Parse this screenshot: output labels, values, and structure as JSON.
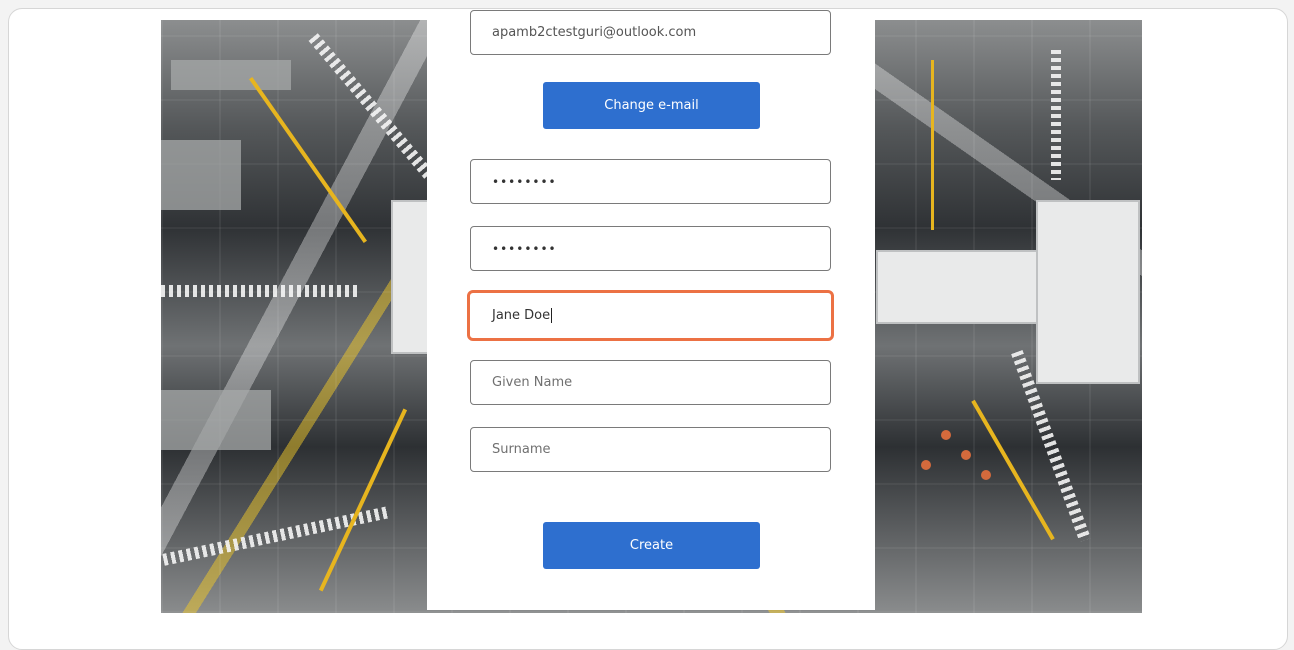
{
  "form": {
    "email_value": "apamb2ctestguri@outlook.com",
    "change_email_label": "Change e-mail",
    "new_password_value": "••••••••",
    "confirm_password_value": "••••••••",
    "display_name_value": "Jane Doe",
    "given_name_placeholder": "Given Name",
    "surname_placeholder": "Surname",
    "create_label": "Create"
  },
  "colors": {
    "primary_button": "#2e6fcf",
    "focus_outline": "#ec7144"
  }
}
